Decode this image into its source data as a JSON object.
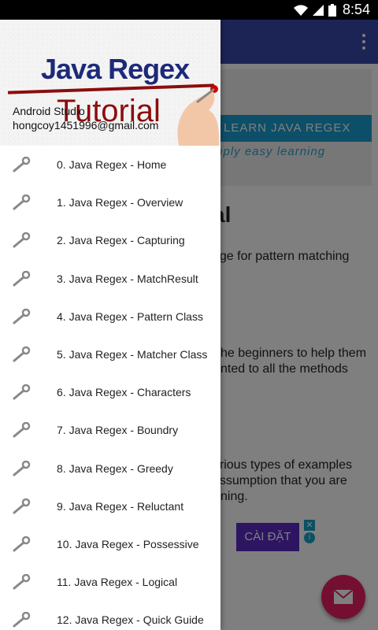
{
  "status_bar": {
    "time": "8:54"
  },
  "drawer": {
    "header": {
      "logo_line1": "Java Regex",
      "logo_line2": "Tutorial",
      "app_name": "Android Studio",
      "email": "hongcoy1451996@gmail.com"
    },
    "items": [
      {
        "label": "0. Java Regex - Home",
        "icon": "wrench-icon"
      },
      {
        "label": "1. Java Regex - Overview",
        "icon": "wrench-icon"
      },
      {
        "label": "2. Java Regex - Capturing",
        "icon": "wrench-icon"
      },
      {
        "label": "3. Java Regex - MatchResult",
        "icon": "wrench-icon"
      },
      {
        "label": "4. Java Regex - Pattern Class",
        "icon": "wrench-icon"
      },
      {
        "label": "5. Java Regex - Matcher Class",
        "icon": "wrench-icon"
      },
      {
        "label": "6. Java Regex - Characters",
        "icon": "wrench-icon"
      },
      {
        "label": "7. Java Regex - Boundry",
        "icon": "wrench-icon"
      },
      {
        "label": "8. Java Regex - Greedy",
        "icon": "wrench-icon"
      },
      {
        "label": "9. Java Regex - Reluctant",
        "icon": "wrench-icon"
      },
      {
        "label": "10. Java Regex - Possessive",
        "icon": "wrench-icon"
      },
      {
        "label": "11. Java Regex - Logical",
        "icon": "wrench-icon"
      },
      {
        "label": "12. Java Regex - Quick Guide",
        "icon": "wrench-icon"
      }
    ]
  },
  "background": {
    "banner_button": "LEARN JAVA REGEX",
    "banner_tagline": "mply easy learning",
    "title_fragment": "al",
    "line1": "age for pattern matching",
    "line2": "he beginners to help them",
    "line3": "nted to all the methods",
    "line4": "arious types of examples",
    "line5": "assumption that you are",
    "line6": "ning.",
    "ad_button": "CÀI ĐẶT"
  },
  "colors": {
    "toolbar": "#3949ab",
    "fab": "#e91e63",
    "ad_button": "#5b2ac4"
  }
}
